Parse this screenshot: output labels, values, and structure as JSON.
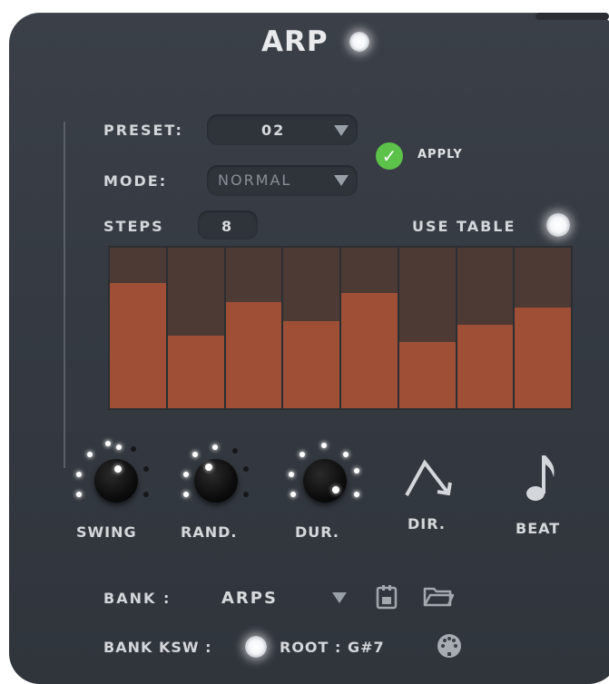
{
  "header": {
    "title": "ARP"
  },
  "preset": {
    "label": "PRESET:",
    "value": "02"
  },
  "mode": {
    "label": "MODE:",
    "value": "NORMAL"
  },
  "apply": {
    "label": "APPLY"
  },
  "steps": {
    "label": "STEPS",
    "value": "8"
  },
  "use_table": {
    "label": "USE TABLE"
  },
  "step_table": {
    "levels": [
      0.78,
      0.45,
      0.66,
      0.54,
      0.72,
      0.41,
      0.52,
      0.63
    ]
  },
  "knobs": [
    {
      "label": "SWING"
    },
    {
      "label": "RAND."
    },
    {
      "label": "DUR."
    }
  ],
  "buttons": {
    "dir_label": "DIR.",
    "beat_label": "BEAT"
  },
  "bank": {
    "label": "BANK :",
    "value": "ARPS"
  },
  "bank_ksw": {
    "label": "BANK KSW :"
  },
  "root": {
    "label": "ROOT : G#7"
  },
  "colors": {
    "accent": "#9e4f36",
    "panel": "#363b43",
    "apply_green": "#5cc24a"
  },
  "icons": [
    "dropdown-arrow-icon",
    "check-icon",
    "save-icon",
    "folder-icon",
    "midi-icon",
    "direction-icon",
    "music-note-icon"
  ]
}
